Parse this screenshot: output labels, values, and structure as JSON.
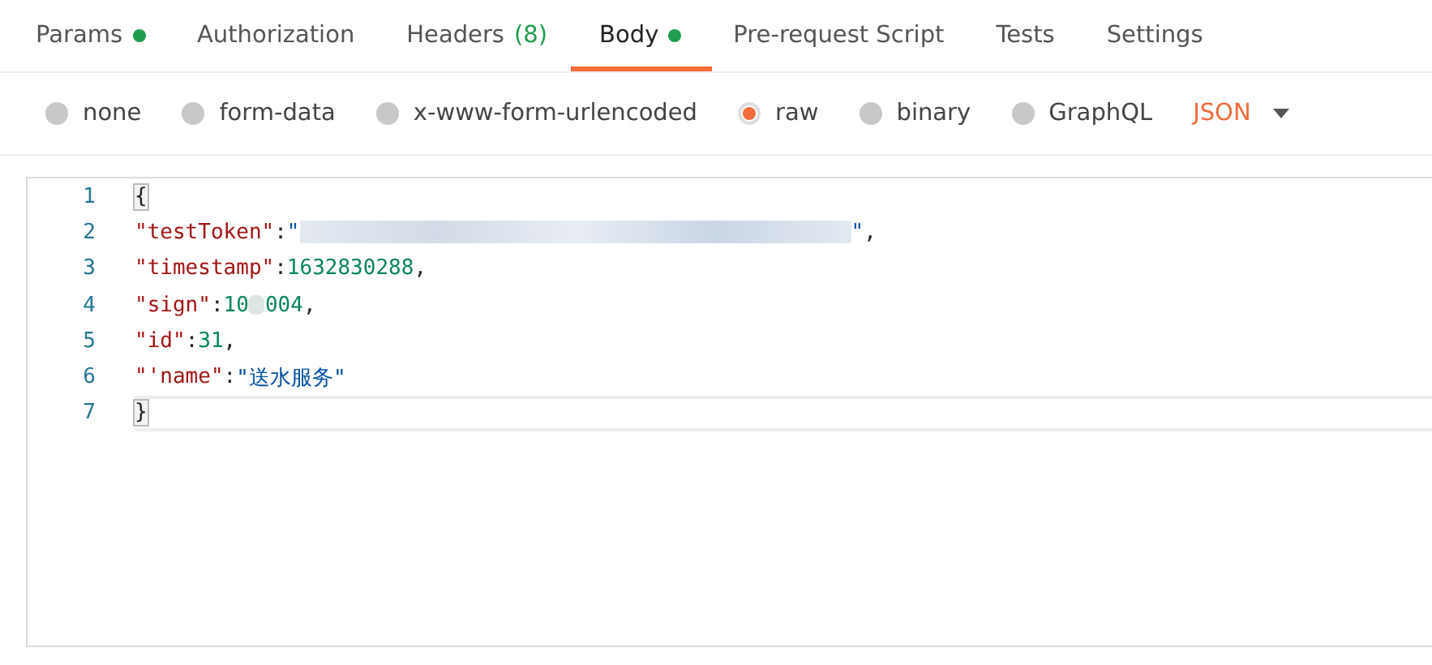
{
  "tabs": [
    {
      "label": "Params",
      "dot": true,
      "selected": false
    },
    {
      "label": "Authorization",
      "dot": false,
      "selected": false
    },
    {
      "label": "Headers",
      "count": "(8)",
      "dot": false,
      "selected": false
    },
    {
      "label": "Body",
      "dot": true,
      "selected": true
    },
    {
      "label": "Pre-request Script",
      "dot": false,
      "selected": false
    },
    {
      "label": "Tests",
      "dot": false,
      "selected": false
    },
    {
      "label": "Settings",
      "dot": false,
      "selected": false
    }
  ],
  "body_types": [
    {
      "label": "none",
      "selected": false
    },
    {
      "label": "form-data",
      "selected": false
    },
    {
      "label": "x-www-form-urlencoded",
      "selected": false
    },
    {
      "label": "raw",
      "selected": true
    },
    {
      "label": "binary",
      "selected": false
    },
    {
      "label": "GraphQL",
      "selected": false
    }
  ],
  "format": {
    "value": "JSON"
  },
  "editor": {
    "lines": [
      {
        "number": "1",
        "current": false,
        "tokens": [
          {
            "kind": "bracket",
            "text": "{"
          }
        ]
      },
      {
        "number": "2",
        "current": false,
        "tokens": [
          {
            "kind": "key",
            "text": "\"testToken\""
          },
          {
            "kind": "punct",
            "text": ":"
          },
          {
            "kind": "string",
            "text": "\""
          },
          {
            "kind": "redacted"
          },
          {
            "kind": "string",
            "text": "\""
          },
          {
            "kind": "punct",
            "text": ","
          }
        ]
      },
      {
        "number": "3",
        "current": false,
        "tokens": [
          {
            "kind": "key",
            "text": "\"timestamp\""
          },
          {
            "kind": "punct",
            "text": ":"
          },
          {
            "kind": "number",
            "text": "1632830288"
          },
          {
            "kind": "punct",
            "text": ","
          }
        ]
      },
      {
        "number": "4",
        "current": false,
        "tokens": [
          {
            "kind": "key",
            "text": "\"sign\""
          },
          {
            "kind": "punct",
            "text": ":"
          },
          {
            "kind": "number",
            "text": "10"
          },
          {
            "kind": "redacted-short"
          },
          {
            "kind": "number",
            "text": "004"
          },
          {
            "kind": "punct",
            "text": ","
          }
        ]
      },
      {
        "number": "5",
        "current": false,
        "tokens": [
          {
            "kind": "key",
            "text": "\"id\""
          },
          {
            "kind": "punct",
            "text": ":"
          },
          {
            "kind": "number",
            "text": "31"
          },
          {
            "kind": "punct",
            "text": ","
          }
        ]
      },
      {
        "number": "6",
        "current": false,
        "tokens": [
          {
            "kind": "key",
            "text": "\"'name\""
          },
          {
            "kind": "punct",
            "text": ":"
          },
          {
            "kind": "string",
            "text": "\"送水服务\""
          }
        ]
      },
      {
        "number": "7",
        "current": true,
        "tokens": [
          {
            "kind": "bracket",
            "text": "}"
          }
        ]
      }
    ]
  }
}
